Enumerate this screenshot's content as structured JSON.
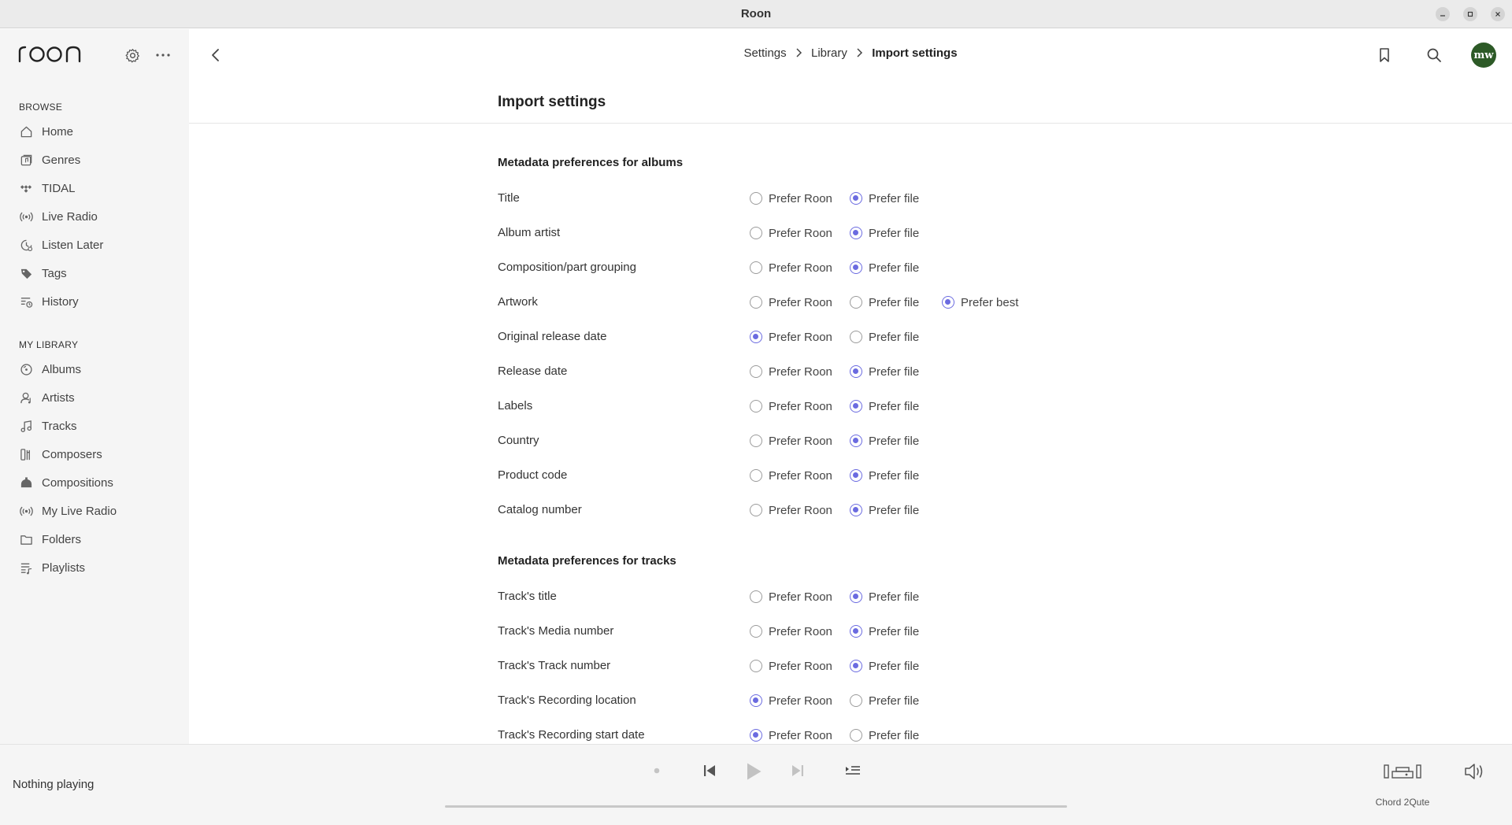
{
  "window": {
    "title": "Roon"
  },
  "sidebar": {
    "browse_heading": "BROWSE",
    "browse": [
      {
        "label": "Home",
        "icon": "home-icon"
      },
      {
        "label": "Genres",
        "icon": "genres-icon"
      },
      {
        "label": "TIDAL",
        "icon": "tidal-icon"
      },
      {
        "label": "Live Radio",
        "icon": "radio-icon"
      },
      {
        "label": "Listen Later",
        "icon": "clock-icon"
      },
      {
        "label": "Tags",
        "icon": "tag-icon"
      },
      {
        "label": "History",
        "icon": "history-icon"
      }
    ],
    "library_heading": "MY LIBRARY",
    "library": [
      {
        "label": "Albums",
        "icon": "album-icon"
      },
      {
        "label": "Artists",
        "icon": "artist-icon"
      },
      {
        "label": "Tracks",
        "icon": "music-note-icon"
      },
      {
        "label": "Composers",
        "icon": "composer-icon"
      },
      {
        "label": "Compositions",
        "icon": "composition-icon"
      },
      {
        "label": "My Live Radio",
        "icon": "radio-icon"
      },
      {
        "label": "Folders",
        "icon": "folder-icon"
      },
      {
        "label": "Playlists",
        "icon": "playlist-icon"
      }
    ]
  },
  "header": {
    "breadcrumb": [
      "Settings",
      "Library",
      "Import settings"
    ],
    "avatar_initials": "mw",
    "page_title": "Import settings"
  },
  "accent_color": "#6b6be0",
  "groups": [
    {
      "title": "Metadata preferences for albums",
      "rows": [
        {
          "label": "Title",
          "options": [
            "Prefer Roon",
            "Prefer file"
          ],
          "selected": 1
        },
        {
          "label": "Album artist",
          "options": [
            "Prefer Roon",
            "Prefer file"
          ],
          "selected": 1
        },
        {
          "label": "Composition/part grouping",
          "options": [
            "Prefer Roon",
            "Prefer file"
          ],
          "selected": 1
        },
        {
          "label": "Artwork",
          "options": [
            "Prefer Roon",
            "Prefer file",
            "Prefer best"
          ],
          "selected": 2
        },
        {
          "label": "Original release date",
          "options": [
            "Prefer Roon",
            "Prefer file"
          ],
          "selected": 0
        },
        {
          "label": "Release date",
          "options": [
            "Prefer Roon",
            "Prefer file"
          ],
          "selected": 1
        },
        {
          "label": "Labels",
          "options": [
            "Prefer Roon",
            "Prefer file"
          ],
          "selected": 1
        },
        {
          "label": "Country",
          "options": [
            "Prefer Roon",
            "Prefer file"
          ],
          "selected": 1
        },
        {
          "label": "Product code",
          "options": [
            "Prefer Roon",
            "Prefer file"
          ],
          "selected": 1
        },
        {
          "label": "Catalog number",
          "options": [
            "Prefer Roon",
            "Prefer file"
          ],
          "selected": 1
        }
      ]
    },
    {
      "title": "Metadata preferences for tracks",
      "rows": [
        {
          "label": "Track's title",
          "options": [
            "Prefer Roon",
            "Prefer file"
          ],
          "selected": 1
        },
        {
          "label": "Track's Media number",
          "options": [
            "Prefer Roon",
            "Prefer file"
          ],
          "selected": 1
        },
        {
          "label": "Track's Track number",
          "options": [
            "Prefer Roon",
            "Prefer file"
          ],
          "selected": 1
        },
        {
          "label": "Track's Recording location",
          "options": [
            "Prefer Roon",
            "Prefer file"
          ],
          "selected": 0
        },
        {
          "label": "Track's Recording start date",
          "options": [
            "Prefer Roon",
            "Prefer file"
          ],
          "selected": 0
        }
      ]
    }
  ],
  "player": {
    "now_playing": "Nothing playing",
    "zone": "Chord 2Qute"
  }
}
